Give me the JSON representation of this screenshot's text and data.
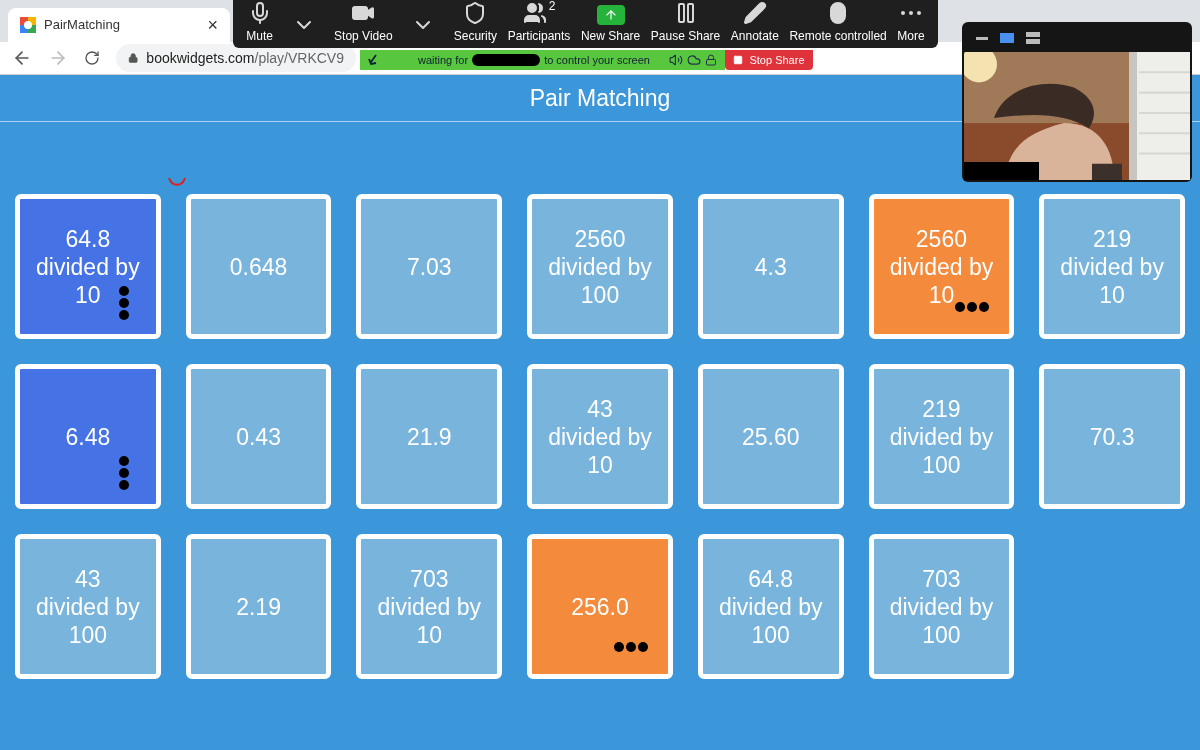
{
  "browser": {
    "tab": {
      "title": "PairMatching",
      "close": "×"
    },
    "url": {
      "host": "bookwidgets.com",
      "path": "/play/VRKCV9"
    }
  },
  "meeting_toolbar": {
    "items": [
      {
        "kind": "mic",
        "label": "Mute"
      },
      {
        "kind": "caret"
      },
      {
        "kind": "video",
        "label": "Stop Video"
      },
      {
        "kind": "caret"
      },
      {
        "kind": "shield",
        "label": "Security"
      },
      {
        "kind": "people",
        "label": "Participants",
        "count": "2"
      },
      {
        "kind": "share",
        "label": "New Share"
      },
      {
        "kind": "pause",
        "label": "Pause Share"
      },
      {
        "kind": "pencil",
        "label": "Annotate"
      },
      {
        "kind": "mouse",
        "label": "Remote controlled"
      },
      {
        "kind": "dots",
        "label": "More"
      }
    ]
  },
  "share_bar": {
    "before": "waiting for",
    "after": "to control your screen",
    "stop": "Stop Share"
  },
  "page": {
    "title": "Pair Matching"
  },
  "tiles": [
    {
      "lines": [
        "64.8",
        "divided by",
        "10"
      ],
      "kind": "selected"
    },
    {
      "lines": [
        "0.648"
      ],
      "kind": "plain"
    },
    {
      "lines": [
        "7.03"
      ],
      "kind": "plain"
    },
    {
      "lines": [
        "2560",
        "divided by",
        "100"
      ],
      "kind": "plain"
    },
    {
      "lines": [
        "4.3"
      ],
      "kind": "plain"
    },
    {
      "lines": [
        "2560",
        "divided by",
        "10"
      ],
      "kind": "partner"
    },
    {
      "lines": [
        "219",
        "divided by",
        "10"
      ],
      "kind": "plain"
    },
    {
      "lines": [
        "6.48"
      ],
      "kind": "selected"
    },
    {
      "lines": [
        "0.43"
      ],
      "kind": "plain"
    },
    {
      "lines": [
        "21.9"
      ],
      "kind": "plain"
    },
    {
      "lines": [
        "43",
        "divided by",
        "10"
      ],
      "kind": "plain"
    },
    {
      "lines": [
        "25.60"
      ],
      "kind": "plain"
    },
    {
      "lines": [
        "219",
        "divided by",
        "100"
      ],
      "kind": "plain"
    },
    {
      "lines": [
        "70.3"
      ],
      "kind": "plain"
    },
    {
      "lines": [
        "43",
        "divided by",
        "100"
      ],
      "kind": "plain"
    },
    {
      "lines": [
        "2.19"
      ],
      "kind": "plain"
    },
    {
      "lines": [
        "703",
        "divided by",
        "10"
      ],
      "kind": "plain"
    },
    {
      "lines": [
        "256.0"
      ],
      "kind": "partner"
    },
    {
      "lines": [
        "64.8",
        "divided by",
        "100"
      ],
      "kind": "plain"
    },
    {
      "lines": [
        "703",
        "divided by",
        "100"
      ],
      "kind": "plain"
    }
  ]
}
